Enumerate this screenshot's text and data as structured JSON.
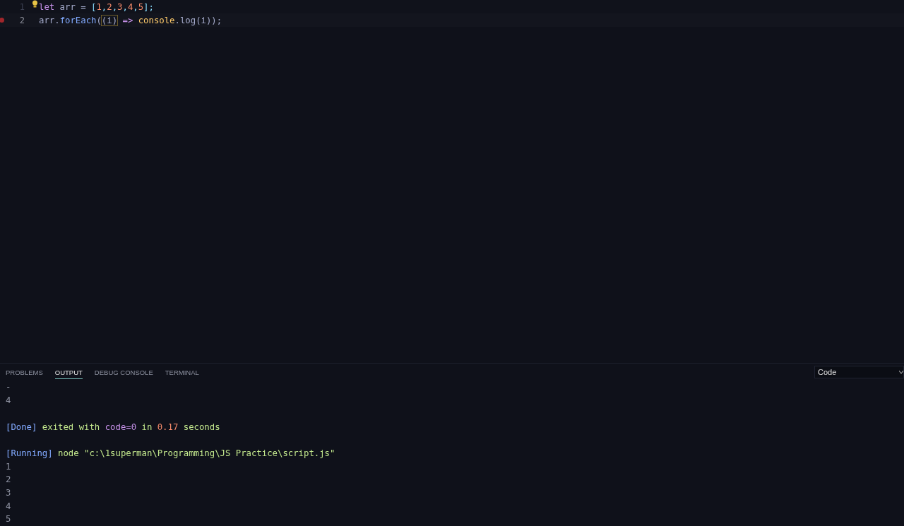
{
  "editor": {
    "lines": [
      {
        "number": "1",
        "breakpoint": false,
        "lightbulb": true,
        "tokens": [
          {
            "kind": "keyword",
            "text": "let"
          },
          {
            "kind": "plain",
            "text": " arr = "
          },
          {
            "kind": "punct",
            "text": "["
          },
          {
            "kind": "number",
            "text": "1"
          },
          {
            "kind": "punct",
            "text": ","
          },
          {
            "kind": "number",
            "text": "2"
          },
          {
            "kind": "punct",
            "text": ","
          },
          {
            "kind": "number",
            "text": "3"
          },
          {
            "kind": "punct",
            "text": ","
          },
          {
            "kind": "number",
            "text": "4"
          },
          {
            "kind": "punct",
            "text": ","
          },
          {
            "kind": "number",
            "text": "5"
          },
          {
            "kind": "punct",
            "text": "];"
          }
        ]
      },
      {
        "number": "2",
        "breakpoint": true,
        "lightbulb": false,
        "tokens": [
          {
            "kind": "plain",
            "text": "arr."
          },
          {
            "kind": "function",
            "text": "forEach"
          },
          {
            "kind": "plain",
            "text": "("
          },
          {
            "kind": "bracket",
            "text": "(i)"
          },
          {
            "kind": "operator",
            "text": " => "
          },
          {
            "kind": "object",
            "text": "console"
          },
          {
            "kind": "plain",
            "text": ".log(i));"
          }
        ]
      }
    ]
  },
  "panel": {
    "tabs": [
      {
        "label": "PROBLEMS",
        "selected": false
      },
      {
        "label": "OUTPUT",
        "selected": true
      },
      {
        "label": "DEBUG CONSOLE",
        "selected": false
      },
      {
        "label": "TERMINAL",
        "selected": false
      }
    ],
    "channel_select": {
      "value": "Code"
    },
    "output": [
      {
        "kind": "text",
        "segments": [
          {
            "kind": "plain",
            "text": "-"
          }
        ]
      },
      {
        "kind": "text",
        "segments": [
          {
            "kind": "plain",
            "text": "4"
          }
        ]
      },
      {
        "kind": "blank"
      },
      {
        "kind": "text",
        "segments": [
          {
            "kind": "tag",
            "text": "[Done]"
          },
          {
            "kind": "green",
            "text": " exited with "
          },
          {
            "kind": "purple",
            "text": "code=0"
          },
          {
            "kind": "green",
            "text": " in "
          },
          {
            "kind": "orange",
            "text": "0.17"
          },
          {
            "kind": "green",
            "text": " seconds"
          }
        ]
      },
      {
        "kind": "blank"
      },
      {
        "kind": "text",
        "segments": [
          {
            "kind": "tag",
            "text": "[Running]"
          },
          {
            "kind": "green",
            "text": " node \"c:\\1superman\\Programming\\JS Practice\\script.js\""
          }
        ]
      },
      {
        "kind": "text",
        "segments": [
          {
            "kind": "plain",
            "text": "1"
          }
        ]
      },
      {
        "kind": "text",
        "segments": [
          {
            "kind": "plain",
            "text": "2"
          }
        ]
      },
      {
        "kind": "text",
        "segments": [
          {
            "kind": "plain",
            "text": "3"
          }
        ]
      },
      {
        "kind": "text",
        "segments": [
          {
            "kind": "plain",
            "text": "4"
          }
        ]
      },
      {
        "kind": "text",
        "segments": [
          {
            "kind": "plain",
            "text": "5"
          }
        ]
      }
    ]
  }
}
